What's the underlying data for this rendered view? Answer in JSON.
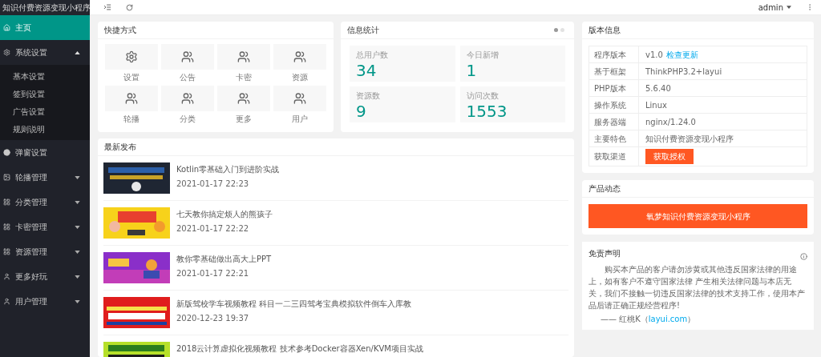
{
  "app_title": "知识付费资源变现小程序",
  "sidebar": {
    "items": [
      {
        "label": "主页",
        "selected": true
      },
      {
        "label": "系统设置",
        "selected": false,
        "expanded": true,
        "children": [
          {
            "label": "基本设置"
          },
          {
            "label": "签到设置"
          },
          {
            "label": "广告设置"
          },
          {
            "label": "规则说明"
          }
        ]
      },
      {
        "label": "弹窗设置",
        "selected": false
      },
      {
        "label": "轮播管理",
        "selected": false,
        "expanded": false
      },
      {
        "label": "分类管理",
        "selected": false,
        "expanded": false
      },
      {
        "label": "卡密管理",
        "selected": false,
        "expanded": false
      },
      {
        "label": "资源管理",
        "selected": false,
        "expanded": false
      },
      {
        "label": "更多好玩",
        "selected": false,
        "expanded": false
      },
      {
        "label": "用户管理",
        "selected": false,
        "expanded": false
      }
    ]
  },
  "header": {
    "user": "admin"
  },
  "shortcuts": {
    "title": "快捷方式",
    "items": [
      {
        "label": "设置"
      },
      {
        "label": "公告"
      },
      {
        "label": "卡密"
      },
      {
        "label": "资源"
      },
      {
        "label": "轮播"
      },
      {
        "label": "分类"
      },
      {
        "label": "更多"
      },
      {
        "label": "用户"
      }
    ]
  },
  "stats": {
    "title": "信息统计",
    "indicators": [
      {
        "selected": true
      },
      {
        "selected": false
      }
    ],
    "items": [
      {
        "label": "总用户数",
        "value": "34"
      },
      {
        "label": "今日新增",
        "value": "1"
      },
      {
        "label": "资源数",
        "value": "9"
      },
      {
        "label": "访问次数",
        "value": "1553"
      }
    ]
  },
  "latest": {
    "title": "最新发布",
    "items": [
      {
        "title": "Kotlin零基础入门到进阶实战",
        "date": "2021-01-17 22:23"
      },
      {
        "title": "七天教你搞定烦人的熊孩子",
        "date": "2021-01-17 22:22"
      },
      {
        "title": "教你零基础做出高大上PPT",
        "date": "2021-01-17 22:21"
      },
      {
        "title": "新版驾校学车视频教程 科目一二三四驾考宝典模拟软件倒车入库教",
        "date": "2020-12-23 19:37"
      },
      {
        "title": "2018云计算虚拟化视频教程 技术参考Docker容器Xen/KVM项目实战"
      }
    ]
  },
  "version": {
    "title": "版本信息",
    "rows": [
      {
        "label": "程序版本",
        "value": "v1.0",
        "link": "检查更新"
      },
      {
        "label": "基于框架",
        "value": "ThinkPHP3.2+layui"
      },
      {
        "label": "PHP版本",
        "value": "5.6.40"
      },
      {
        "label": "操作系统",
        "value": "Linux"
      },
      {
        "label": "服务器端",
        "value": "nginx/1.24.0"
      },
      {
        "label": "主要特色",
        "value": "知识付费资源变现小程序"
      },
      {
        "label": "获取渠道",
        "button": "获取授权"
      }
    ]
  },
  "product": {
    "title": "产品动态",
    "banner": "氧梦知识付费资源变现小程序"
  },
  "disclaimer": {
    "title": "免责声明",
    "text": "购买本产品的客户请勿涉黄或其他违反国家法律的用途上，如有客户不遵守国家法律 产生相关法律问题与本店无关，我们不接触一切违反国家法律的技术支持工作，使用本产品后请正确正规经营程序!",
    "signature": "—— 红桃K（",
    "link": "layui.com",
    "signature_end": "）"
  }
}
